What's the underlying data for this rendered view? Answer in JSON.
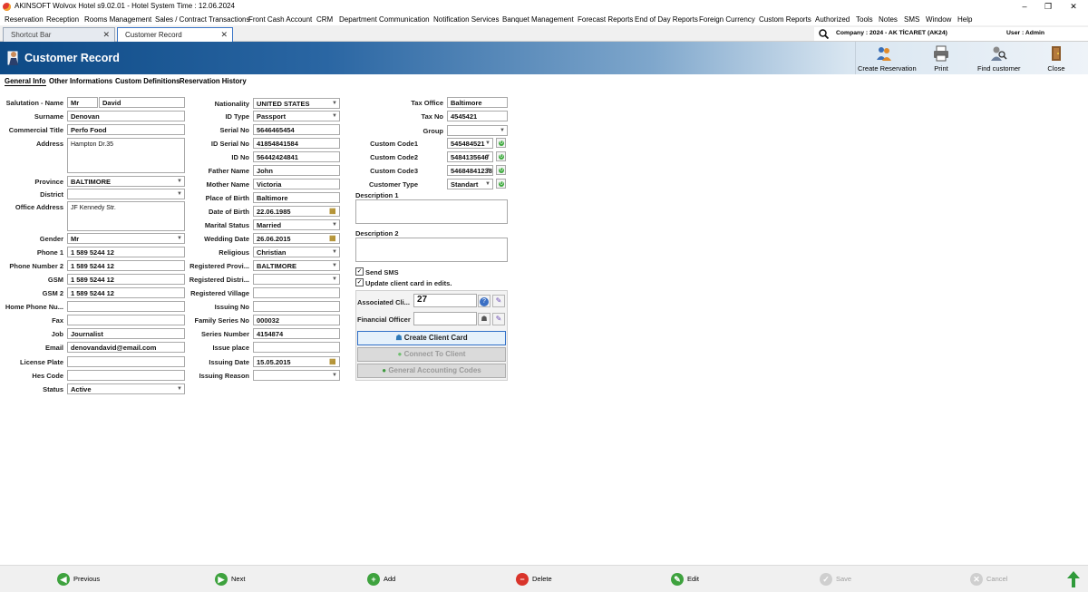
{
  "window": {
    "title": "AKINSOFT Wolvox Hotel s9.02.01 - Hotel System Time : 12.06.2024",
    "controls": [
      "–",
      "❐",
      "✕"
    ]
  },
  "menu": [
    "Reservation",
    "Reception",
    "Rooms Management",
    "Sales / Contract Transactions",
    "Front Cash Account",
    "CRM",
    "Department Communication",
    "Notification Services",
    "Banquet Management",
    "Forecast Reports",
    "End of Day Reports",
    "Foreign Currency",
    "Custom Reports",
    "Authorized",
    "Tools",
    "Notes",
    "SMS",
    "Window",
    "Help"
  ],
  "tabs": [
    {
      "label": "Shortcut Bar"
    },
    {
      "label": "Customer Record"
    }
  ],
  "company": "Company : 2024 - AK TİCARET (AK24)",
  "user": "User : Admin",
  "header": {
    "title": "Customer Record",
    "toolbar": [
      "Create Reservation",
      "Print",
      "Find customer",
      "Close"
    ]
  },
  "subtabs": [
    "General Info",
    "Other Informations",
    "Custom Definitions",
    "Reservation History"
  ],
  "col1": {
    "labels": [
      "Salutation - Name",
      "Surname",
      "Commercial Title",
      "Address",
      "Province",
      "District",
      "Office Address",
      "Gender",
      "Phone 1",
      "Phone Number 2",
      "GSM",
      "GSM 2",
      "Home Phone Nu...",
      "Fax",
      "Job",
      "Email",
      "License Plate",
      "Hes Code",
      "Status"
    ],
    "salutation": "Mr",
    "name": "David",
    "surname": "Denovan",
    "commercial_title": "Perfo Food",
    "address": "Hampton Dr.35",
    "province": "BALTIMORE",
    "district": "",
    "office_address": "JF Kennedy Str.",
    "gender": "Mr",
    "phone1": "1 589 5244 12",
    "phone2": "1 589 5244 12",
    "gsm": "1 589 5244 12",
    "gsm2": "1 589 5244 12",
    "home_phone": "",
    "fax": "",
    "job": "Journalist",
    "email": "denovandavid@email.com",
    "license_plate": "",
    "hes_code": "",
    "status": "Active"
  },
  "col2": {
    "labels": [
      "Nationality",
      "ID Type",
      "Serial No",
      "ID Serial No",
      "ID No",
      "Father Name",
      "Mother Name",
      "Place of Birth",
      "Date of Birth",
      "Marital Status",
      "Wedding Date",
      "Religious",
      "Registered Provi...",
      "Registered Distri...",
      "Registered Village",
      "Issuing No",
      "Family Series No",
      "Series Number",
      "Issue place",
      "Issuing Date",
      "Issuing Reason"
    ],
    "nationality": "UNITED STATES",
    "id_type": "Passport",
    "serial_no": "5646465454",
    "id_serial_no": "41854841584",
    "id_no": "56442424841",
    "father_name": "John",
    "mother_name": "Victoria",
    "place_of_birth": "Baltimore",
    "date_of_birth": "22.06.1985",
    "marital_status": "Married",
    "wedding_date": "26.06.2015",
    "religious": "Christian",
    "registered_province": "BALTIMORE",
    "registered_district": "",
    "registered_village": "",
    "issuing_no": "",
    "family_series_no": "000032",
    "series_number": "4154874",
    "issue_place": "",
    "issuing_date": "15.05.2015",
    "issuing_reason": ""
  },
  "col3": {
    "labels": [
      "Tax Office",
      "Tax No",
      "Group",
      "Custom Code1",
      "Custom Code2",
      "Custom Code3",
      "Customer Type"
    ],
    "tax_office": "Baltimore",
    "tax_no": "4545421",
    "group": "",
    "custom_code1": "545484521",
    "custom_code2": "5484135646",
    "custom_code3": "54684841238",
    "customer_type": "Standart",
    "description1_label": "Description 1",
    "description2_label": "Description 2",
    "send_sms": "Send SMS",
    "update_card": "Update client card in edits.",
    "associated_label": "Associated Cli...",
    "associated_value": "27",
    "financial_officer_label": "Financial Officer",
    "create_client_card": "Create Client Card",
    "connect_to_client": "Connect To Client",
    "general_accounting_codes": "General Accounting Codes"
  },
  "bottom": [
    "Previous",
    "Next",
    "Add",
    "Delete",
    "Edit",
    "Save",
    "Cancel"
  ],
  "colors": {
    "header_dark": "#0d4a86",
    "active_tab_border": "#3b76c7",
    "green": "#3eaa3e",
    "red": "#d9342b"
  }
}
